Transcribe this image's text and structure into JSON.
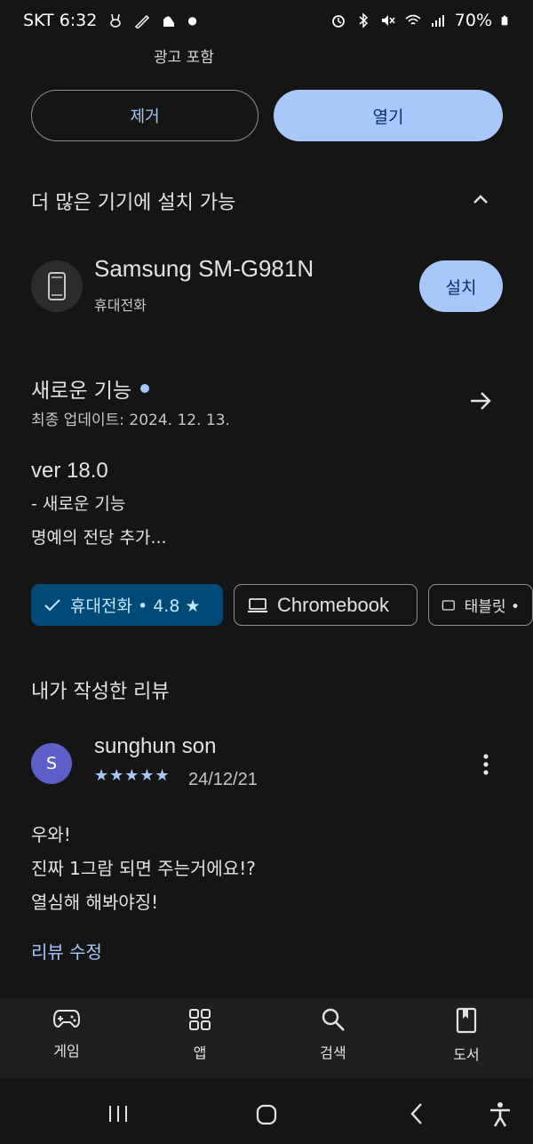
{
  "status_bar": {
    "carrier_time": "SKT 6:32",
    "battery": "70%"
  },
  "ad_notice": "광고 포함",
  "actions": {
    "uninstall": "제거",
    "open": "열기"
  },
  "more_devices": {
    "title": "더 많은 기기에 설치 가능",
    "device_name": "Samsung SM-G981N",
    "device_type": "휴대전화",
    "install": "설치"
  },
  "whats_new": {
    "title": "새로운 기능",
    "last_updated": "최종 업데이트: 2024. 12. 13.",
    "lines": [
      "ver 18.0",
      "- 새로운 기능",
      "명예의 전당 추가..."
    ]
  },
  "device_chips": [
    {
      "label": "휴대전화 • 4.8 ★",
      "selected": true
    },
    {
      "label": "Chromebook",
      "selected": false
    },
    {
      "label": "태블릿 •",
      "selected": false
    }
  ],
  "my_review": {
    "title": "내가 작성한 리뷰",
    "avatar_initial": "S",
    "reviewer": "sunghun son",
    "stars": "★★★★★",
    "date": "24/12/21",
    "text_lines": [
      "우와!",
      "진짜 1그람 되면 주는거에요!?",
      "열심해 해봐야징!"
    ],
    "edit": "리뷰 수정"
  },
  "bottom_nav": [
    {
      "label": "게임",
      "icon": "gamepad-icon"
    },
    {
      "label": "앱",
      "icon": "apps-grid-icon"
    },
    {
      "label": "검색",
      "icon": "search-icon"
    },
    {
      "label": "도서",
      "icon": "book-icon"
    }
  ],
  "colors": {
    "accent": "#a8c7fa",
    "background": "#151515",
    "chip_selected": "#004a77"
  }
}
